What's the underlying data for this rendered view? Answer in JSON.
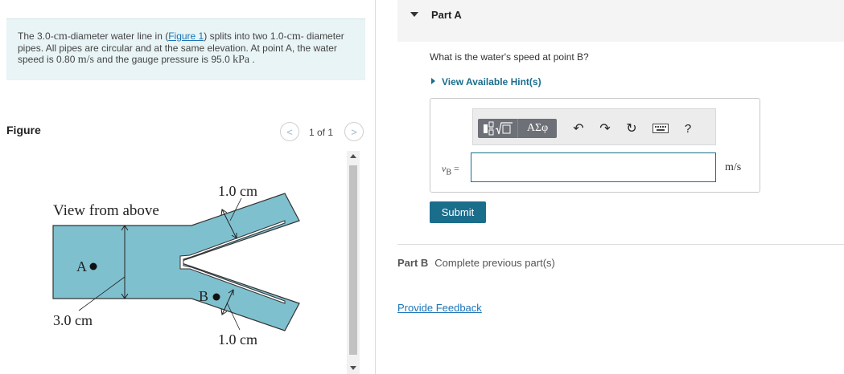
{
  "problem": {
    "t1": "The 3.0-",
    "u1": "cm",
    "t2": "-diameter water line in (",
    "link": "Figure 1",
    "t3": ") splits into two 1.0-",
    "u2": "cm",
    "t4": "- diameter pipes. All pipes are circular and at the same elevation. At point A, the water speed is 0.80 ",
    "u3": "m/s",
    "t5": " and the gauge pressure is 95.0 ",
    "u4": "kPa",
    "t6": " ."
  },
  "figure": {
    "label": "Figure",
    "page_indicator": "1 of 1",
    "prev_glyph": "<",
    "next_glyph": ">",
    "view_label": "View from above",
    "dim_top": "1.0 cm",
    "dim_bottom": "1.0 cm",
    "dim_main": "3.0 cm",
    "point_a": "A",
    "point_b": "B",
    "pipe_color": "#7fc0cf"
  },
  "part_a": {
    "title": "Part A",
    "question": "What is the water's speed at point B?",
    "hints": "View Available Hint(s)",
    "toolbar": {
      "greek": "ΑΣφ",
      "undo": "↶",
      "redo": "↷",
      "reset": "↻",
      "help": "?"
    },
    "var_symbol": "v",
    "var_sub": "B",
    "var_eq": " =",
    "input_value": "",
    "unit": "m/s",
    "submit": "Submit"
  },
  "part_b": {
    "title": "Part B",
    "text": "Complete previous part(s)"
  },
  "feedback": "Provide Feedback",
  "colors": {
    "accent": "#1b6d8c",
    "link": "#1a74b8",
    "problem_bg": "#e8f4f5"
  }
}
